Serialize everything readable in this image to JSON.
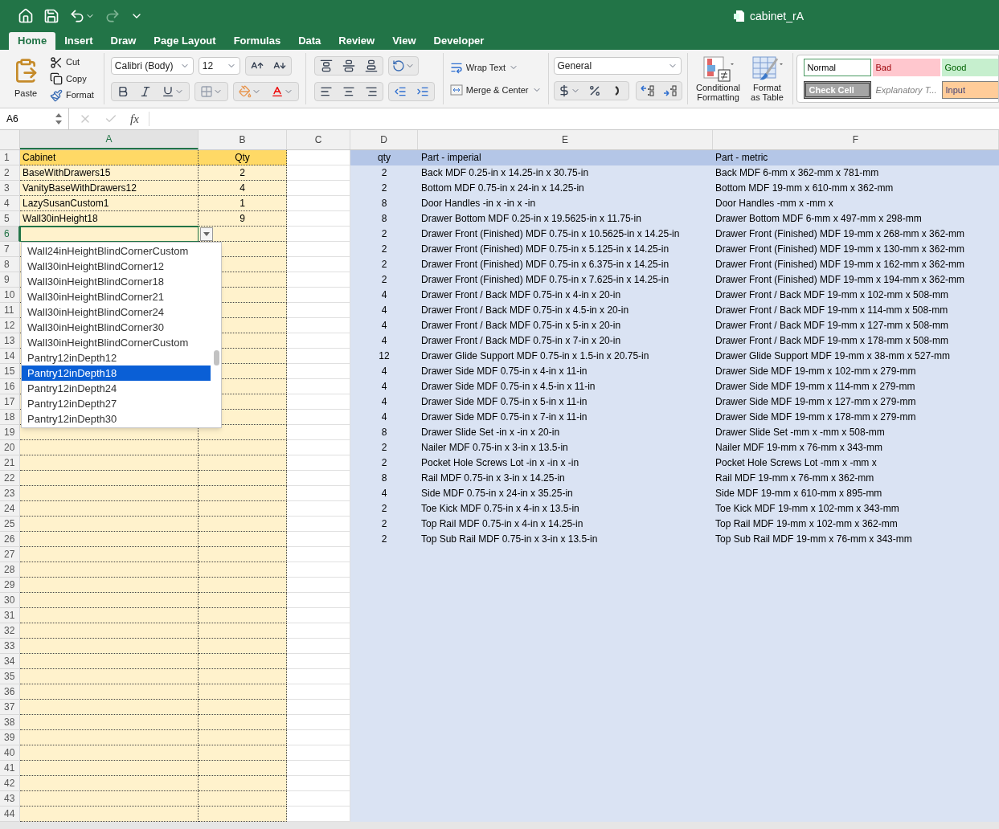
{
  "window": {
    "title": "cabinet_rA"
  },
  "tabs": [
    {
      "label": "Home",
      "selected": true
    },
    {
      "label": "Insert",
      "selected": false
    },
    {
      "label": "Draw",
      "selected": false
    },
    {
      "label": "Page Layout",
      "selected": false
    },
    {
      "label": "Formulas",
      "selected": false
    },
    {
      "label": "Data",
      "selected": false
    },
    {
      "label": "Review",
      "selected": false
    },
    {
      "label": "View",
      "selected": false
    },
    {
      "label": "Developer",
      "selected": false
    }
  ],
  "ribbon": {
    "paste": "Paste",
    "cut": "Cut",
    "copy": "Copy",
    "format_painter": "Format",
    "font_name": "Calibri (Body)",
    "font_size": "12",
    "wrap_text": "Wrap Text",
    "merge_center": "Merge & Center",
    "number_format": "General",
    "conditional_formatting": "Conditional Formatting",
    "format_as_table": "Format as Table",
    "cell_styles": [
      {
        "label": "Normal",
        "kind": "normal"
      },
      {
        "label": "Bad",
        "kind": "bad"
      },
      {
        "label": "Good",
        "kind": "good"
      },
      {
        "label": "Check Cell",
        "kind": "check"
      },
      {
        "label": "Explanatory T...",
        "kind": "explanatory"
      },
      {
        "label": "Input",
        "kind": "input"
      }
    ]
  },
  "formula_bar": {
    "name_box": "A6",
    "fx": "fx"
  },
  "columns": [
    {
      "label": "A",
      "selected": true
    },
    {
      "label": "B",
      "selected": false
    },
    {
      "label": "C",
      "selected": false
    },
    {
      "label": "D",
      "selected": false
    },
    {
      "label": "E",
      "selected": false
    },
    {
      "label": "F",
      "selected": false
    }
  ],
  "rows": [
    {
      "label": "1",
      "selected": false
    },
    {
      "label": "2",
      "selected": false
    },
    {
      "label": "3",
      "selected": false
    },
    {
      "label": "4",
      "selected": false
    },
    {
      "label": "5",
      "selected": false
    },
    {
      "label": "6",
      "selected": true
    },
    {
      "label": "7",
      "selected": false
    },
    {
      "label": "8",
      "selected": false
    },
    {
      "label": "9",
      "selected": false
    },
    {
      "label": "10",
      "selected": false
    },
    {
      "label": "11",
      "selected": false
    },
    {
      "label": "12",
      "selected": false
    },
    {
      "label": "13",
      "selected": false
    },
    {
      "label": "14",
      "selected": false
    },
    {
      "label": "15",
      "selected": false
    },
    {
      "label": "16",
      "selected": false
    },
    {
      "label": "17",
      "selected": false
    },
    {
      "label": "18",
      "selected": false
    },
    {
      "label": "19",
      "selected": false
    },
    {
      "label": "20",
      "selected": false
    },
    {
      "label": "21",
      "selected": false
    },
    {
      "label": "22",
      "selected": false
    },
    {
      "label": "23",
      "selected": false
    },
    {
      "label": "24",
      "selected": false
    },
    {
      "label": "25",
      "selected": false
    },
    {
      "label": "26",
      "selected": false
    },
    {
      "label": "27",
      "selected": false
    },
    {
      "label": "28",
      "selected": false
    },
    {
      "label": "29",
      "selected": false
    },
    {
      "label": "30",
      "selected": false
    },
    {
      "label": "31",
      "selected": false
    },
    {
      "label": "32",
      "selected": false
    },
    {
      "label": "33",
      "selected": false
    },
    {
      "label": "34",
      "selected": false
    },
    {
      "label": "35",
      "selected": false
    },
    {
      "label": "36",
      "selected": false
    },
    {
      "label": "37",
      "selected": false
    },
    {
      "label": "38",
      "selected": false
    },
    {
      "label": "39",
      "selected": false
    },
    {
      "label": "40",
      "selected": false
    },
    {
      "label": "41",
      "selected": false
    },
    {
      "label": "42",
      "selected": false
    },
    {
      "label": "43",
      "selected": false
    },
    {
      "label": "44",
      "selected": false
    }
  ],
  "cabinet_table": {
    "headers": [
      "Cabinet",
      "Qty"
    ],
    "rows": [
      {
        "cabinet": "BaseWithDrawers15",
        "qty": "2"
      },
      {
        "cabinet": "VanityBaseWithDrawers12",
        "qty": "4"
      },
      {
        "cabinet": "LazySusanCustom1",
        "qty": "1"
      },
      {
        "cabinet": "Wall30inHeight18",
        "qty": "9"
      }
    ]
  },
  "parts_table": {
    "headers": [
      "qty",
      "Part - imperial",
      "Part - metric"
    ],
    "rows": [
      {
        "qty": "2",
        "imperial": "Back MDF 0.25-in x 14.25-in x 30.75-in",
        "metric": "Back MDF 6-mm x 362-mm x 781-mm"
      },
      {
        "qty": "2",
        "imperial": "Bottom MDF 0.75-in x 24-in x 14.25-in",
        "metric": "Bottom MDF 19-mm x 610-mm x 362-mm"
      },
      {
        "qty": "8",
        "imperial": "Door Handles  -in x -in x -in",
        "metric": "Door Handles  -mm x -mm x"
      },
      {
        "qty": "8",
        "imperial": "Drawer Bottom MDF 0.25-in x 19.5625-in x 11.75-in",
        "metric": "Drawer Bottom MDF 6-mm x 497-mm x 298-mm"
      },
      {
        "qty": "2",
        "imperial": "Drawer Front (Finished) MDF 0.75-in x 10.5625-in x 14.25-in",
        "metric": "Drawer Front (Finished) MDF 19-mm x 268-mm x 362-mm"
      },
      {
        "qty": "2",
        "imperial": "Drawer Front (Finished) MDF 0.75-in x 5.125-in x 14.25-in",
        "metric": "Drawer Front (Finished) MDF 19-mm x 130-mm x 362-mm"
      },
      {
        "qty": "2",
        "imperial": "Drawer Front (Finished) MDF 0.75-in x 6.375-in x 14.25-in",
        "metric": "Drawer Front (Finished) MDF 19-mm x 162-mm x 362-mm"
      },
      {
        "qty": "2",
        "imperial": "Drawer Front (Finished) MDF 0.75-in x 7.625-in x 14.25-in",
        "metric": "Drawer Front (Finished) MDF 19-mm x 194-mm x 362-mm"
      },
      {
        "qty": "4",
        "imperial": "Drawer Front / Back MDF 0.75-in x 4-in x 20-in",
        "metric": "Drawer Front / Back MDF 19-mm x 102-mm x 508-mm"
      },
      {
        "qty": "4",
        "imperial": "Drawer Front / Back MDF 0.75-in x 4.5-in x 20-in",
        "metric": "Drawer Front / Back MDF 19-mm x 114-mm x 508-mm"
      },
      {
        "qty": "4",
        "imperial": "Drawer Front / Back MDF 0.75-in x 5-in x 20-in",
        "metric": "Drawer Front / Back MDF 19-mm x 127-mm x 508-mm"
      },
      {
        "qty": "4",
        "imperial": "Drawer Front / Back MDF 0.75-in x 7-in x 20-in",
        "metric": "Drawer Front / Back MDF 19-mm x 178-mm x 508-mm"
      },
      {
        "qty": "12",
        "imperial": "Drawer Glide Support MDF 0.75-in x 1.5-in x 20.75-in",
        "metric": "Drawer Glide Support MDF 19-mm x 38-mm x 527-mm"
      },
      {
        "qty": "4",
        "imperial": "Drawer Side MDF 0.75-in x 4-in x 11-in",
        "metric": "Drawer Side MDF 19-mm x 102-mm x 279-mm"
      },
      {
        "qty": "4",
        "imperial": "Drawer Side MDF 0.75-in x 4.5-in x 11-in",
        "metric": "Drawer Side MDF 19-mm x 114-mm x 279-mm"
      },
      {
        "qty": "4",
        "imperial": "Drawer Side MDF 0.75-in x 5-in x 11-in",
        "metric": "Drawer Side MDF 19-mm x 127-mm x 279-mm"
      },
      {
        "qty": "4",
        "imperial": "Drawer Side MDF 0.75-in x 7-in x 11-in",
        "metric": "Drawer Side MDF 19-mm x 178-mm x 279-mm"
      },
      {
        "qty": "8",
        "imperial": "Drawer Slide Set  -in x -in x 20-in",
        "metric": "Drawer Slide Set  -mm x -mm x 508-mm"
      },
      {
        "qty": "2",
        "imperial": "Nailer MDF 0.75-in x 3-in x 13.5-in",
        "metric": "Nailer MDF 19-mm x 76-mm x 343-mm"
      },
      {
        "qty": "2",
        "imperial": "Pocket Hole Screws Lot  -in x -in x -in",
        "metric": "Pocket Hole Screws Lot  -mm x -mm x"
      },
      {
        "qty": "8",
        "imperial": "Rail MDF 0.75-in x 3-in x 14.25-in",
        "metric": "Rail MDF 19-mm x 76-mm x 362-mm"
      },
      {
        "qty": "4",
        "imperial": "Side MDF 0.75-in x 24-in x 35.25-in",
        "metric": "Side MDF 19-mm x 610-mm x 895-mm"
      },
      {
        "qty": "2",
        "imperial": "Toe Kick MDF 0.75-in x 4-in x 13.5-in",
        "metric": "Toe Kick MDF 19-mm x 102-mm x 343-mm"
      },
      {
        "qty": "2",
        "imperial": "Top Rail MDF 0.75-in x 4-in x 14.25-in",
        "metric": "Top Rail MDF 19-mm x 102-mm x 362-mm"
      },
      {
        "qty": "2",
        "imperial": "Top Sub Rail MDF 0.75-in x 3-in x 13.5-in",
        "metric": "Top Sub Rail MDF 19-mm x 76-mm x 343-mm"
      }
    ]
  },
  "dropdown": {
    "items": [
      {
        "label": "Wall24inHeightBlindCornerCustom",
        "selected": false
      },
      {
        "label": "Wall30inHeightBlindCorner12",
        "selected": false
      },
      {
        "label": "Wall30inHeightBlindCorner18",
        "selected": false
      },
      {
        "label": "Wall30inHeightBlindCorner21",
        "selected": false
      },
      {
        "label": "Wall30inHeightBlindCorner24",
        "selected": false
      },
      {
        "label": "Wall30inHeightBlindCorner30",
        "selected": false
      },
      {
        "label": "Wall30inHeightBlindCornerCustom",
        "selected": false
      },
      {
        "label": "Pantry12inDepth12",
        "selected": false
      },
      {
        "label": "Pantry12inDepth18",
        "selected": true
      },
      {
        "label": "Pantry12inDepth24",
        "selected": false
      },
      {
        "label": "Pantry12inDepth27",
        "selected": false
      },
      {
        "label": "Pantry12inDepth30",
        "selected": false
      }
    ]
  }
}
